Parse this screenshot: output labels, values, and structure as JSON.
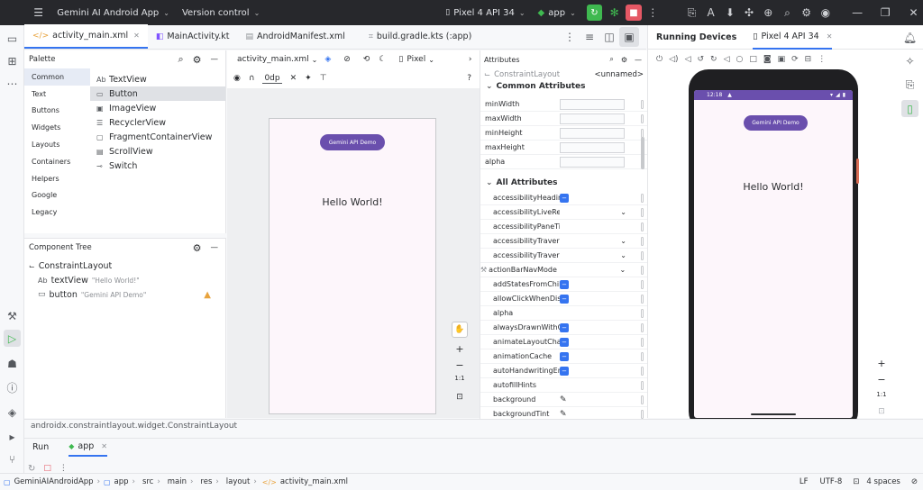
{
  "titlebar": {
    "project": "Gemini AI Android App",
    "vcs": "Version control",
    "device": "Pixel 4 API 34",
    "run_config": "app"
  },
  "tabs": [
    {
      "label": "activity_main.xml",
      "active": true
    },
    {
      "label": "MainActivity.kt"
    },
    {
      "label": "AndroidManifest.xml"
    },
    {
      "label": "build.gradle.kts (:app)"
    }
  ],
  "palette": {
    "title": "Palette",
    "categories": [
      "Common",
      "Text",
      "Buttons",
      "Widgets",
      "Layouts",
      "Containers",
      "Helpers",
      "Google",
      "Legacy"
    ],
    "items": [
      {
        "icon": "Ab",
        "label": "TextView"
      },
      {
        "icon": "▭",
        "label": "Button"
      },
      {
        "icon": "▣",
        "label": "ImageView"
      },
      {
        "icon": "☰",
        "label": "RecyclerView"
      },
      {
        "icon": "▢",
        "label": "FragmentContainerView"
      },
      {
        "icon": "▤",
        "label": "ScrollView"
      },
      {
        "icon": "⊸",
        "label": "Switch"
      }
    ]
  },
  "tree": {
    "title": "Component Tree",
    "root": "ConstraintLayout",
    "children": [
      {
        "icon": "Ab",
        "name": "textView",
        "hint": "\"Hello World!\""
      },
      {
        "icon": "▭",
        "name": "button",
        "hint": "\"Gemini API Demo\""
      }
    ]
  },
  "canvas_toolbar": {
    "file": "activity_main.xml",
    "device": "Pixel",
    "margin": "0dp"
  },
  "preview": {
    "button_text": "Gemini API Demo",
    "text": "Hello World!",
    "zoom_label": "1:1"
  },
  "attributes": {
    "title": "Attributes",
    "component": "ConstraintLayout",
    "id_value": "<unnamed>",
    "common_header": "Common Attributes",
    "common": [
      "minWidth",
      "maxWidth",
      "minHeight",
      "maxHeight",
      "alpha"
    ],
    "all_header": "All Attributes",
    "all": [
      {
        "name": "accessibilityHeading",
        "kind": "check"
      },
      {
        "name": "accessibilityLiveRegi...",
        "kind": "dropdown"
      },
      {
        "name": "accessibilityPaneTitle",
        "kind": "none"
      },
      {
        "name": "accessibilityTravers...",
        "kind": "dropdown"
      },
      {
        "name": "accessibilityTravers...",
        "kind": "dropdown"
      },
      {
        "name": "actionBarNavMode",
        "kind": "dropdown",
        "indent": false
      },
      {
        "name": "addStatesFromChild...",
        "kind": "check"
      },
      {
        "name": "allowClickWhenDisa...",
        "kind": "check"
      },
      {
        "name": "alpha",
        "kind": "none"
      },
      {
        "name": "alwaysDrawnWithCa...",
        "kind": "check"
      },
      {
        "name": "animateLayoutChan...",
        "kind": "check"
      },
      {
        "name": "animationCache",
        "kind": "check"
      },
      {
        "name": "autoHandwritingEna...",
        "kind": "check"
      },
      {
        "name": "autofillHints",
        "kind": "none"
      },
      {
        "name": "background",
        "kind": "pencil"
      },
      {
        "name": "backgroundTint",
        "kind": "pencil"
      }
    ]
  },
  "running_devices": {
    "title": "Running Devices",
    "device_tab": "Pixel 4 API 34",
    "time": "12:18",
    "button_text": "Gemini API Demo",
    "text": "Hello World!",
    "zoom_label": "1:1"
  },
  "bottom": {
    "path": "androidx.constraintlayout.widget.ConstraintLayout",
    "run_label": "Run",
    "run_tab": "app"
  },
  "status": {
    "breadcrumbs": [
      "GeminiAIAndroidApp",
      "app",
      "src",
      "main",
      "res",
      "layout",
      "activity_main.xml"
    ],
    "line_sep": "LF",
    "encoding": "UTF-8",
    "indent": "4 spaces"
  },
  "colors": {
    "accent": "#3574f0",
    "button_purple": "#6a4fad",
    "run_green": "#3fb950",
    "stop_red": "#e55865",
    "warning": "#e8a33d"
  }
}
